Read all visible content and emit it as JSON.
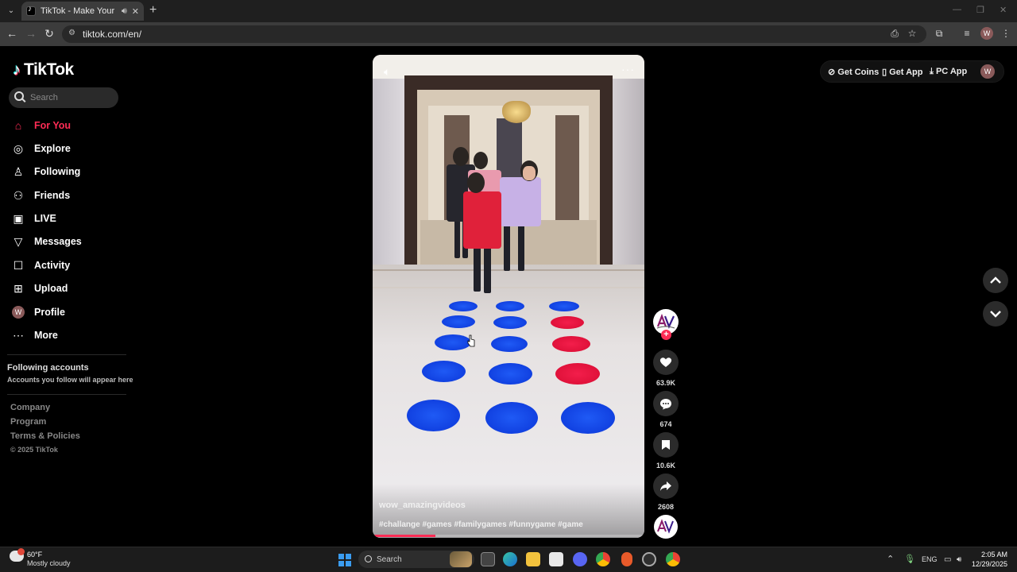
{
  "browser": {
    "tab_title": "TikTok - Make Your Day",
    "url": "tiktok.com/en/"
  },
  "sidebar": {
    "logo_text": "TikTok",
    "search_placeholder": "Search",
    "items": [
      {
        "label": "For You",
        "icon": "home-icon"
      },
      {
        "label": "Explore",
        "icon": "compass-icon"
      },
      {
        "label": "Following",
        "icon": "following-icon"
      },
      {
        "label": "Friends",
        "icon": "friends-icon"
      },
      {
        "label": "LIVE",
        "icon": "live-icon"
      },
      {
        "label": "Messages",
        "icon": "messages-icon"
      },
      {
        "label": "Activity",
        "icon": "activity-icon"
      },
      {
        "label": "Upload",
        "icon": "upload-icon"
      },
      {
        "label": "Profile",
        "icon": "profile-avatar",
        "avatar_letter": "W"
      },
      {
        "label": "More",
        "icon": "more-icon"
      }
    ],
    "following_title": "Following accounts",
    "following_sub": "Accounts you follow will appear here",
    "footer_links": [
      "Company",
      "Program",
      "Terms & Policies"
    ],
    "copyright": "© 2025 TikTok"
  },
  "video": {
    "author": "wow_amazingvideos",
    "hashtags": "#challange #games #familygames #funnygame #game",
    "progress_fraction": 0.23
  },
  "actions": {
    "likes": "63.9K",
    "comments": "674",
    "saves": "10.6K",
    "shares": "2608"
  },
  "topbar": {
    "get_coins": "Get Coins",
    "get_app": "Get App",
    "pc_app": "PC App",
    "avatar_letter": "W"
  },
  "taskbar": {
    "temperature": "60°F",
    "weather": "Mostly cloudy",
    "search_label": "Search",
    "language": "ENG",
    "time": "2:05 AM",
    "date": "12/29/2025"
  },
  "colors": {
    "accent": "#fe2c55",
    "dot_blue": "#1246e8",
    "dot_red": "#e8143f"
  }
}
